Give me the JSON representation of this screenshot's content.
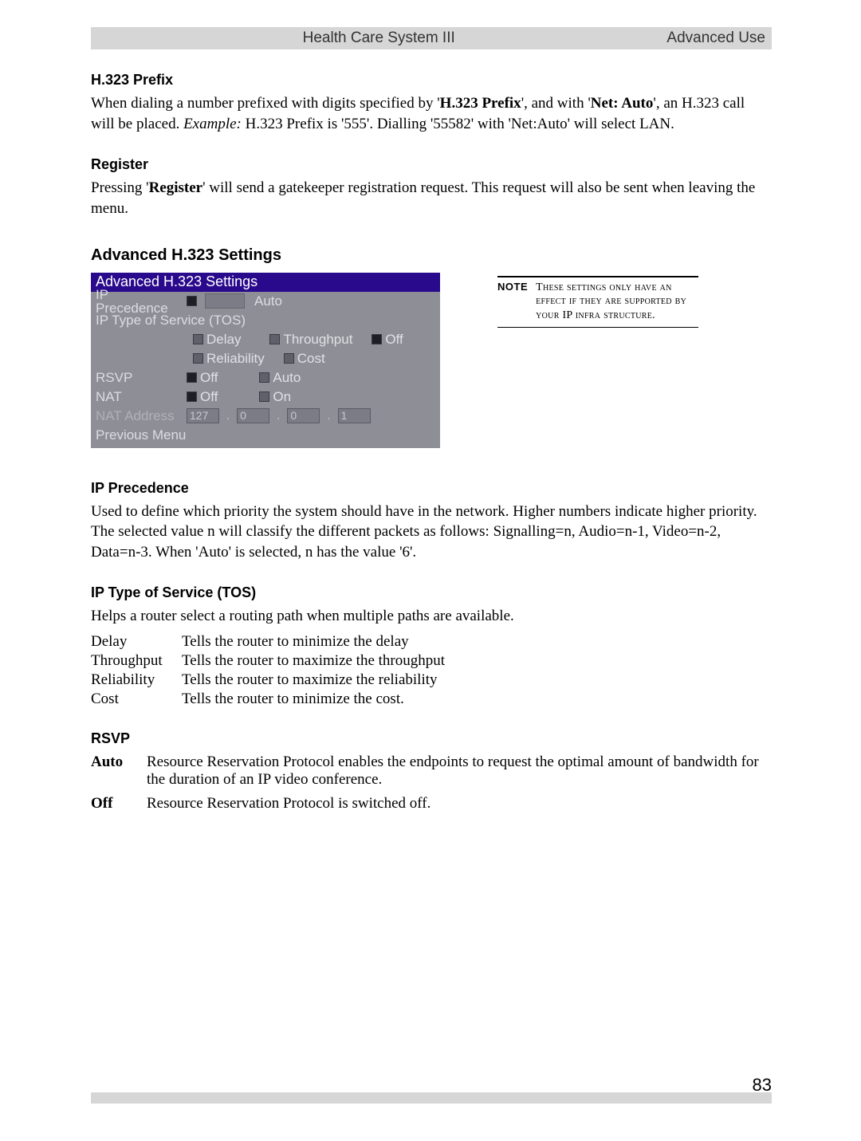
{
  "header": {
    "title": "Health Care System III",
    "section": "Advanced Use"
  },
  "s1": {
    "heading": "H.323 Prefix",
    "p1a": "When dialing a number prefixed with digits specified by '",
    "p1b": "H.323 Prefix",
    "p1c": "', and with '",
    "p1d": "Net: Auto",
    "p1e": "', an H.323 call will be placed. ",
    "p1f": "Example:",
    "p1g": " H.323 Prefix is '555'. Dialling '55582' with 'Net:Auto' will select LAN."
  },
  "s2": {
    "heading": "Register",
    "p1a": "Pressing '",
    "p1b": "Register",
    "p1c": "' will send a gatekeeper registration request. This request will also be sent when leaving the menu."
  },
  "s3": {
    "heading": "Advanced H.323 Settings",
    "note_label": "NOTE",
    "note_text": "These settings only have an effect if they are supported by your IP infra structure."
  },
  "shot": {
    "title": "Advanced H.323 Settings",
    "ip_precedence": "IP Precedence",
    "auto": "Auto",
    "ip_tos": "IP Type of Service (TOS)",
    "delay": "Delay",
    "throughput": "Throughput",
    "off": "Off",
    "reliability": "Reliability",
    "cost": "Cost",
    "rsvp": "RSVP",
    "nat": "NAT",
    "on": "On",
    "nat_addr": "NAT Address",
    "nat_octets": [
      "127",
      "0",
      "0",
      "1"
    ],
    "prev": "Previous Menu"
  },
  "s4": {
    "heading": "IP Precedence",
    "body": "Used to define which priority the system should have in the network. Higher numbers indicate higher priority. The selected value n will classify the different packets as follows: Signalling=n, Audio=n-1, Video=n-2, Data=n-3. When 'Auto' is selected, n has the value '6'."
  },
  "s5": {
    "heading": "IP Type of Service (TOS)",
    "intro": "Helps a router select a routing path when multiple paths are available.",
    "rows": [
      {
        "k": "Delay",
        "v": "Tells the router to minimize the delay"
      },
      {
        "k": "Throughput",
        "v": "Tells the router to maximize the throughput"
      },
      {
        "k": "Reliability",
        "v": "Tells the router to maximize the reliability"
      },
      {
        "k": "Cost",
        "v": "Tells the router to minimize the cost."
      }
    ]
  },
  "s6": {
    "heading": "RSVP",
    "rows": [
      {
        "k": "Auto",
        "v": "Resource Reservation Protocol enables the endpoints to request the optimal amount of bandwidth for the duration of an IP video conference."
      },
      {
        "k": "Off",
        "v": "Resource Reservation Protocol is switched off."
      }
    ]
  },
  "page_number": "83"
}
